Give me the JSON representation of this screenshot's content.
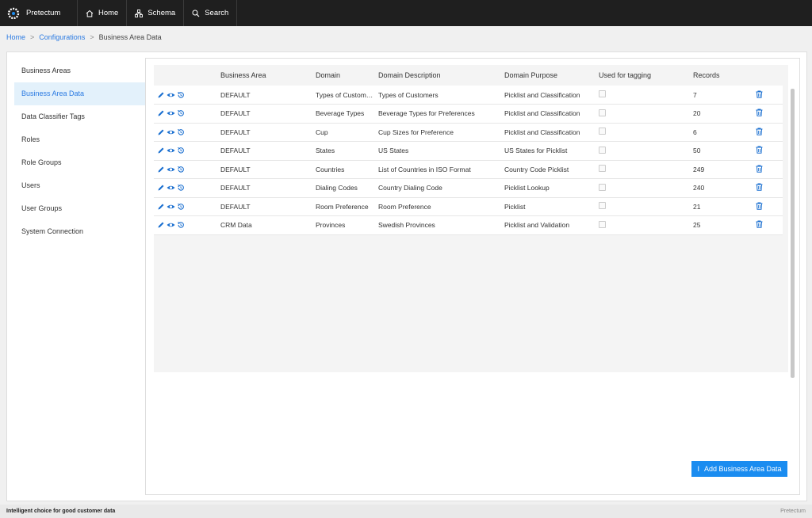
{
  "brand": {
    "name": "Pretectum"
  },
  "nav": [
    {
      "label": "Home",
      "icon": "home-icon"
    },
    {
      "label": "Schema",
      "icon": "schema-icon"
    },
    {
      "label": "Search",
      "icon": "search-icon"
    }
  ],
  "breadcrumb": {
    "home": "Home",
    "configurations": "Configurations",
    "current": "Business Area Data",
    "sep": ">"
  },
  "sidebar": {
    "items": [
      {
        "label": "Business Areas"
      },
      {
        "label": "Business Area Data"
      },
      {
        "label": "Data Classifier Tags"
      },
      {
        "label": "Roles"
      },
      {
        "label": "Role Groups"
      },
      {
        "label": "Users"
      },
      {
        "label": "User Groups"
      },
      {
        "label": "System Connection"
      }
    ],
    "active_index": 1
  },
  "table": {
    "headers": [
      "",
      "Business Area",
      "Domain",
      "Domain Description",
      "Domain Purpose",
      "Used for tagging",
      "Records",
      ""
    ],
    "rows": [
      {
        "business_area": "DEFAULT",
        "domain": "Types of Customers",
        "description": "Types of Customers",
        "purpose": "Picklist and Classification",
        "tagging": false,
        "records": "7"
      },
      {
        "business_area": "DEFAULT",
        "domain": "Beverage Types",
        "description": "Beverage Types for Preferences",
        "purpose": "Picklist and Classification",
        "tagging": false,
        "records": "20"
      },
      {
        "business_area": "DEFAULT",
        "domain": "Cup",
        "description": "Cup Sizes for Preference",
        "purpose": "Picklist and Classification",
        "tagging": false,
        "records": "6"
      },
      {
        "business_area": "DEFAULT",
        "domain": "States",
        "description": "US States",
        "purpose": "US States for Picklist",
        "tagging": false,
        "records": "50"
      },
      {
        "business_area": "DEFAULT",
        "domain": "Countries",
        "description": "List of Countries in ISO Format",
        "purpose": "Country Code Picklist",
        "tagging": false,
        "records": "249"
      },
      {
        "business_area": "DEFAULT",
        "domain": "Dialing Codes",
        "description": "Country Dialing Code",
        "purpose": "Picklist Lookup",
        "tagging": false,
        "records": "240"
      },
      {
        "business_area": "DEFAULT",
        "domain": "Room Preference",
        "description": "Room Preference",
        "purpose": "Picklist",
        "tagging": false,
        "records": "21"
      },
      {
        "business_area": "CRM Data",
        "domain": "Provinces",
        "description": "Swedish Provinces",
        "purpose": "Picklist and Validation",
        "tagging": false,
        "records": "25"
      }
    ]
  },
  "add_button": {
    "label": "Add Business Area Data",
    "icon_glyph": "I"
  },
  "footer": {
    "tagline": "Intelligent choice for good customer data",
    "copyright": "Pretectum"
  },
  "colors": {
    "accent": "#1a8cf0",
    "topbar": "#1f1f1f",
    "active_bg": "#e3f1fb"
  }
}
